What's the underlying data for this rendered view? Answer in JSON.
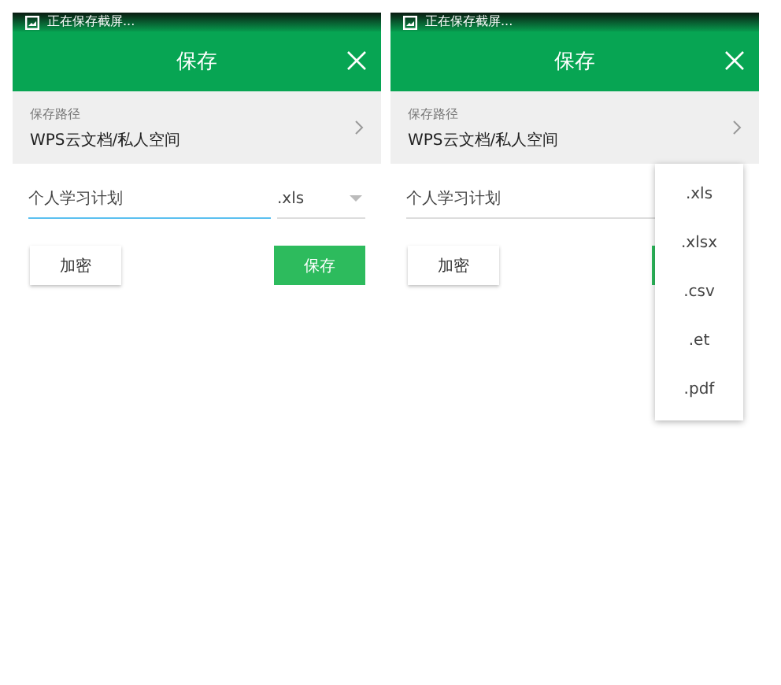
{
  "screens": [
    {
      "status_text": "正在保存截屏...",
      "title": "保存",
      "path_label": "保存路径",
      "path_value": "WPS云文档/私人空间",
      "filename": {
        "value": "个人学习计划",
        "focused": true
      },
      "extension": ".xls",
      "encrypt_button": "加密",
      "save_button": {
        "label": "保存"
      }
    },
    {
      "status_text": "正在保存截屏...",
      "title": "保存",
      "path_label": "保存路径",
      "path_value": "WPS云文档/私人空间",
      "filename": {
        "value": "个人学习计划",
        "focused": false
      },
      "encrypt_button": "加密",
      "dropdown": {
        "options": [
          ".xls",
          ".xlsx",
          ".csv",
          ".et",
          ".pdf"
        ]
      }
    }
  ]
}
